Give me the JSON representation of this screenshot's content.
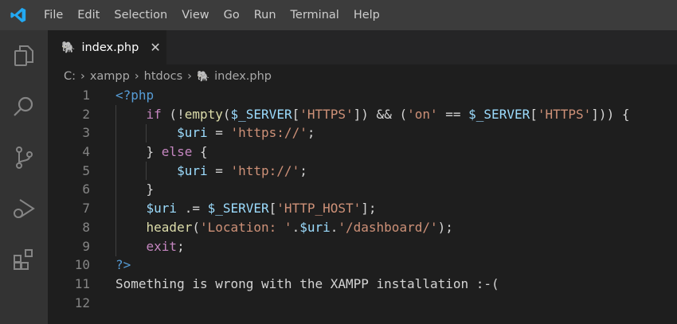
{
  "menu": [
    "File",
    "Edit",
    "Selection",
    "View",
    "Go",
    "Run",
    "Terminal",
    "Help"
  ],
  "tab": {
    "label": "index.php",
    "close": "✕"
  },
  "breadcrumb": [
    "C:",
    "xampp",
    "htdocs",
    "index.php"
  ],
  "lines": [
    {
      "n": "1",
      "t": [
        [
          "tag",
          "<?php"
        ]
      ]
    },
    {
      "n": "2",
      "t": [
        [
          "p",
          "    "
        ],
        [
          "kw",
          "if"
        ],
        [
          "p",
          " (!"
        ],
        [
          "fn",
          "empty"
        ],
        [
          "p",
          "("
        ],
        [
          "var",
          "$_SERVER"
        ],
        [
          "p",
          "["
        ],
        [
          "str",
          "'HTTPS'"
        ],
        [
          "p",
          "]) && ("
        ],
        [
          "str",
          "'on'"
        ],
        [
          "p",
          " == "
        ],
        [
          "var",
          "$_SERVER"
        ],
        [
          "p",
          "["
        ],
        [
          "str",
          "'HTTPS'"
        ],
        [
          "p",
          "])) {"
        ]
      ]
    },
    {
      "n": "3",
      "t": [
        [
          "p",
          "        "
        ],
        [
          "var",
          "$uri"
        ],
        [
          "p",
          " = "
        ],
        [
          "str",
          "'https://'"
        ],
        [
          "p",
          ";"
        ]
      ]
    },
    {
      "n": "4",
      "t": [
        [
          "p",
          "    } "
        ],
        [
          "kw",
          "else"
        ],
        [
          "p",
          " {"
        ]
      ]
    },
    {
      "n": "5",
      "t": [
        [
          "p",
          "        "
        ],
        [
          "var",
          "$uri"
        ],
        [
          "p",
          " = "
        ],
        [
          "str",
          "'http://'"
        ],
        [
          "p",
          ";"
        ]
      ]
    },
    {
      "n": "6",
      "t": [
        [
          "p",
          "    }"
        ]
      ]
    },
    {
      "n": "7",
      "t": [
        [
          "p",
          "    "
        ],
        [
          "var",
          "$uri"
        ],
        [
          "p",
          " .= "
        ],
        [
          "var",
          "$_SERVER"
        ],
        [
          "p",
          "["
        ],
        [
          "str",
          "'HTTP_HOST'"
        ],
        [
          "p",
          "];"
        ]
      ]
    },
    {
      "n": "8",
      "t": [
        [
          "p",
          "    "
        ],
        [
          "fn",
          "header"
        ],
        [
          "p",
          "("
        ],
        [
          "str",
          "'Location: '"
        ],
        [
          "p",
          "."
        ],
        [
          "var",
          "$uri"
        ],
        [
          "p",
          "."
        ],
        [
          "str",
          "'/dashboard/'"
        ],
        [
          "p",
          ");"
        ]
      ]
    },
    {
      "n": "9",
      "t": [
        [
          "p",
          "    "
        ],
        [
          "kw",
          "exit"
        ],
        [
          "p",
          ";"
        ]
      ]
    },
    {
      "n": "10",
      "t": [
        [
          "tag",
          "?>"
        ]
      ]
    },
    {
      "n": "11",
      "t": [
        [
          "p",
          "Something is wrong with the XAMPP installation :-("
        ]
      ]
    },
    {
      "n": "12",
      "t": []
    }
  ]
}
